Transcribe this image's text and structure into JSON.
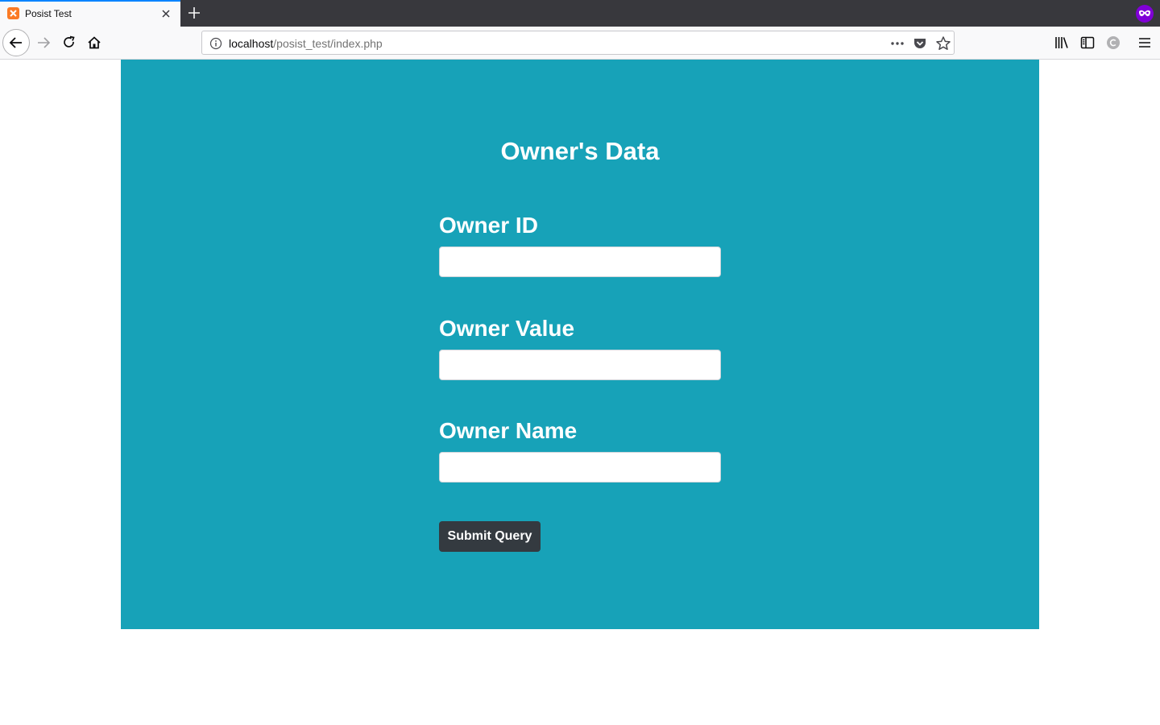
{
  "browser": {
    "tab_title": "Posist Test",
    "url_host": "localhost",
    "url_path": "/posist_test/index.php",
    "accent_color": "#0a84ff",
    "favicon_color": "#fb7a24",
    "extension_color": "#8000d7"
  },
  "page": {
    "background_color": "#17a2b8",
    "title": "Owner's Data",
    "fields": [
      {
        "label": "Owner ID",
        "value": ""
      },
      {
        "label": "Owner Value",
        "value": ""
      },
      {
        "label": "Owner Name",
        "value": ""
      }
    ],
    "submit_label": "Submit Query",
    "submit_color": "#343a40"
  }
}
